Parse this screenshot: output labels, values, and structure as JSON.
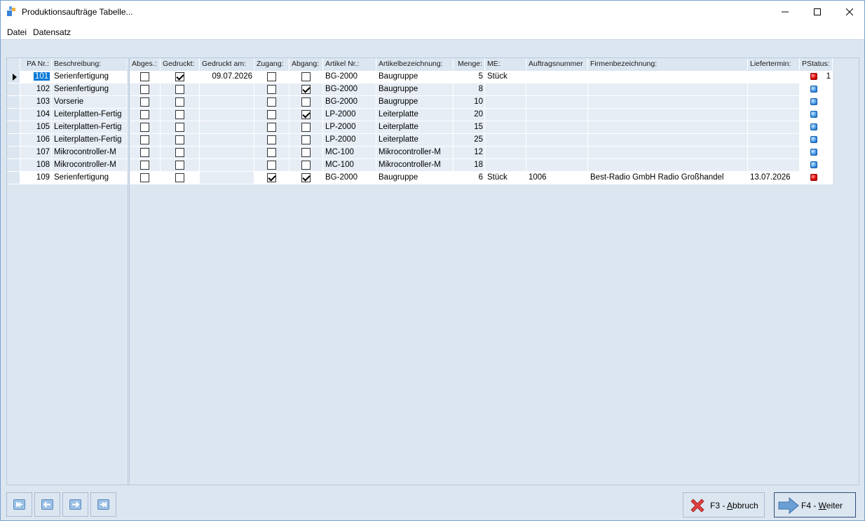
{
  "window": {
    "title": "Produktionsaufträge Tabelle...",
    "controls": {
      "minimize": "—",
      "maximize": "☐",
      "close": "✕"
    }
  },
  "menu": {
    "file": "Datei",
    "record": "Datensatz"
  },
  "columns": {
    "pa_nr": "PA Nr.:",
    "beschreibung": "Beschreibung:",
    "abges": "Abges.:",
    "gedruckt": "Gedruckt:",
    "gedruckt_am": "Gedruckt am:",
    "zugang": "Zugang:",
    "abgang": "Abgang:",
    "artikel_nr": "Artikel Nr.:",
    "artikelbezeichnung": "Artikelbezeichnung:",
    "menge": "Menge:",
    "me": "ME:",
    "auftragsnummer": "Auftragsnummer",
    "firmenbezeichnung": "Firmenbezeichnung:",
    "liefertermin": "Liefertermin:",
    "pstatus": "PStatus:"
  },
  "rows": [
    {
      "pa_nr": "101",
      "beschreibung": "Serienfertigung",
      "abges": false,
      "gedruckt": true,
      "gedruckt_am": "09.07.2026",
      "zugang": false,
      "abgang": false,
      "artikel_nr": "BG-2000",
      "artikelbezeichnung": "Baugruppe",
      "menge": "5",
      "me": "Stück",
      "auftragsnummer": "",
      "firmenbezeichnung": "",
      "liefertermin": "",
      "pstatus": "red",
      "pstatus_text": "1"
    },
    {
      "pa_nr": "102",
      "beschreibung": "Serienfertigung",
      "abges": false,
      "gedruckt": false,
      "gedruckt_am": "",
      "zugang": false,
      "abgang": true,
      "artikel_nr": "BG-2000",
      "artikelbezeichnung": "Baugruppe",
      "menge": "8",
      "me": "",
      "auftragsnummer": "",
      "firmenbezeichnung": "",
      "liefertermin": "",
      "pstatus": "blue",
      "pstatus_text": ""
    },
    {
      "pa_nr": "103",
      "beschreibung": "Vorserie",
      "abges": false,
      "gedruckt": false,
      "gedruckt_am": "",
      "zugang": false,
      "abgang": false,
      "artikel_nr": "BG-2000",
      "artikelbezeichnung": "Baugruppe",
      "menge": "10",
      "me": "",
      "auftragsnummer": "",
      "firmenbezeichnung": "",
      "liefertermin": "",
      "pstatus": "blue",
      "pstatus_text": ""
    },
    {
      "pa_nr": "104",
      "beschreibung": "Leiterplatten-Fertig",
      "abges": false,
      "gedruckt": false,
      "gedruckt_am": "",
      "zugang": false,
      "abgang": true,
      "artikel_nr": "LP-2000",
      "artikelbezeichnung": "Leiterplatte",
      "menge": "20",
      "me": "",
      "auftragsnummer": "",
      "firmenbezeichnung": "",
      "liefertermin": "",
      "pstatus": "blue",
      "pstatus_text": ""
    },
    {
      "pa_nr": "105",
      "beschreibung": "Leiterplatten-Fertig",
      "abges": false,
      "gedruckt": false,
      "gedruckt_am": "",
      "zugang": false,
      "abgang": false,
      "artikel_nr": "LP-2000",
      "artikelbezeichnung": "Leiterplatte",
      "menge": "15",
      "me": "",
      "auftragsnummer": "",
      "firmenbezeichnung": "",
      "liefertermin": "",
      "pstatus": "blue",
      "pstatus_text": ""
    },
    {
      "pa_nr": "106",
      "beschreibung": "Leiterplatten-Fertig",
      "abges": false,
      "gedruckt": false,
      "gedruckt_am": "",
      "zugang": false,
      "abgang": false,
      "artikel_nr": "LP-2000",
      "artikelbezeichnung": "Leiterplatte",
      "menge": "25",
      "me": "",
      "auftragsnummer": "",
      "firmenbezeichnung": "",
      "liefertermin": "",
      "pstatus": "blue",
      "pstatus_text": ""
    },
    {
      "pa_nr": "107",
      "beschreibung": "Mikrocontroller-M",
      "abges": false,
      "gedruckt": false,
      "gedruckt_am": "",
      "zugang": false,
      "abgang": false,
      "artikel_nr": "MC-100",
      "artikelbezeichnung": "Mikrocontroller-M",
      "menge": "12",
      "me": "",
      "auftragsnummer": "",
      "firmenbezeichnung": "",
      "liefertermin": "",
      "pstatus": "blue",
      "pstatus_text": ""
    },
    {
      "pa_nr": "108",
      "beschreibung": "Mikrocontroller-M",
      "abges": false,
      "gedruckt": false,
      "gedruckt_am": "",
      "zugang": false,
      "abgang": false,
      "artikel_nr": "MC-100",
      "artikelbezeichnung": "Mikrocontroller-M",
      "menge": "18",
      "me": "",
      "auftragsnummer": "",
      "firmenbezeichnung": "",
      "liefertermin": "",
      "pstatus": "blue",
      "pstatus_text": ""
    },
    {
      "pa_nr": "109",
      "beschreibung": "Serienfertigung",
      "abges": false,
      "gedruckt": false,
      "gedruckt_am": "",
      "zugang": true,
      "abgang": true,
      "artikel_nr": "BG-2000",
      "artikelbezeichnung": "Baugruppe",
      "menge": "6",
      "me": "Stück",
      "auftragsnummer": "1006",
      "firmenbezeichnung": "Best-Radio GmbH Radio Großhandel",
      "liefertermin": "13.07.2026",
      "pstatus": "red",
      "pstatus_text": ""
    }
  ],
  "buttons": {
    "abbruch_prefix": "F3 - ",
    "abbruch_key": "A",
    "abbruch_rest": "bbruch",
    "weiter_prefix": "F4 - ",
    "weiter_key": "W",
    "weiter_rest": "eiter"
  },
  "nav": {
    "first_icon": "first-record-icon",
    "prev_icon": "prev-record-icon",
    "next_icon": "next-record-icon",
    "last_icon": "last-record-icon"
  },
  "colors": {
    "row_white": "#ffffff",
    "row_alt": "#e6edf5",
    "selection": "#0078d7"
  }
}
